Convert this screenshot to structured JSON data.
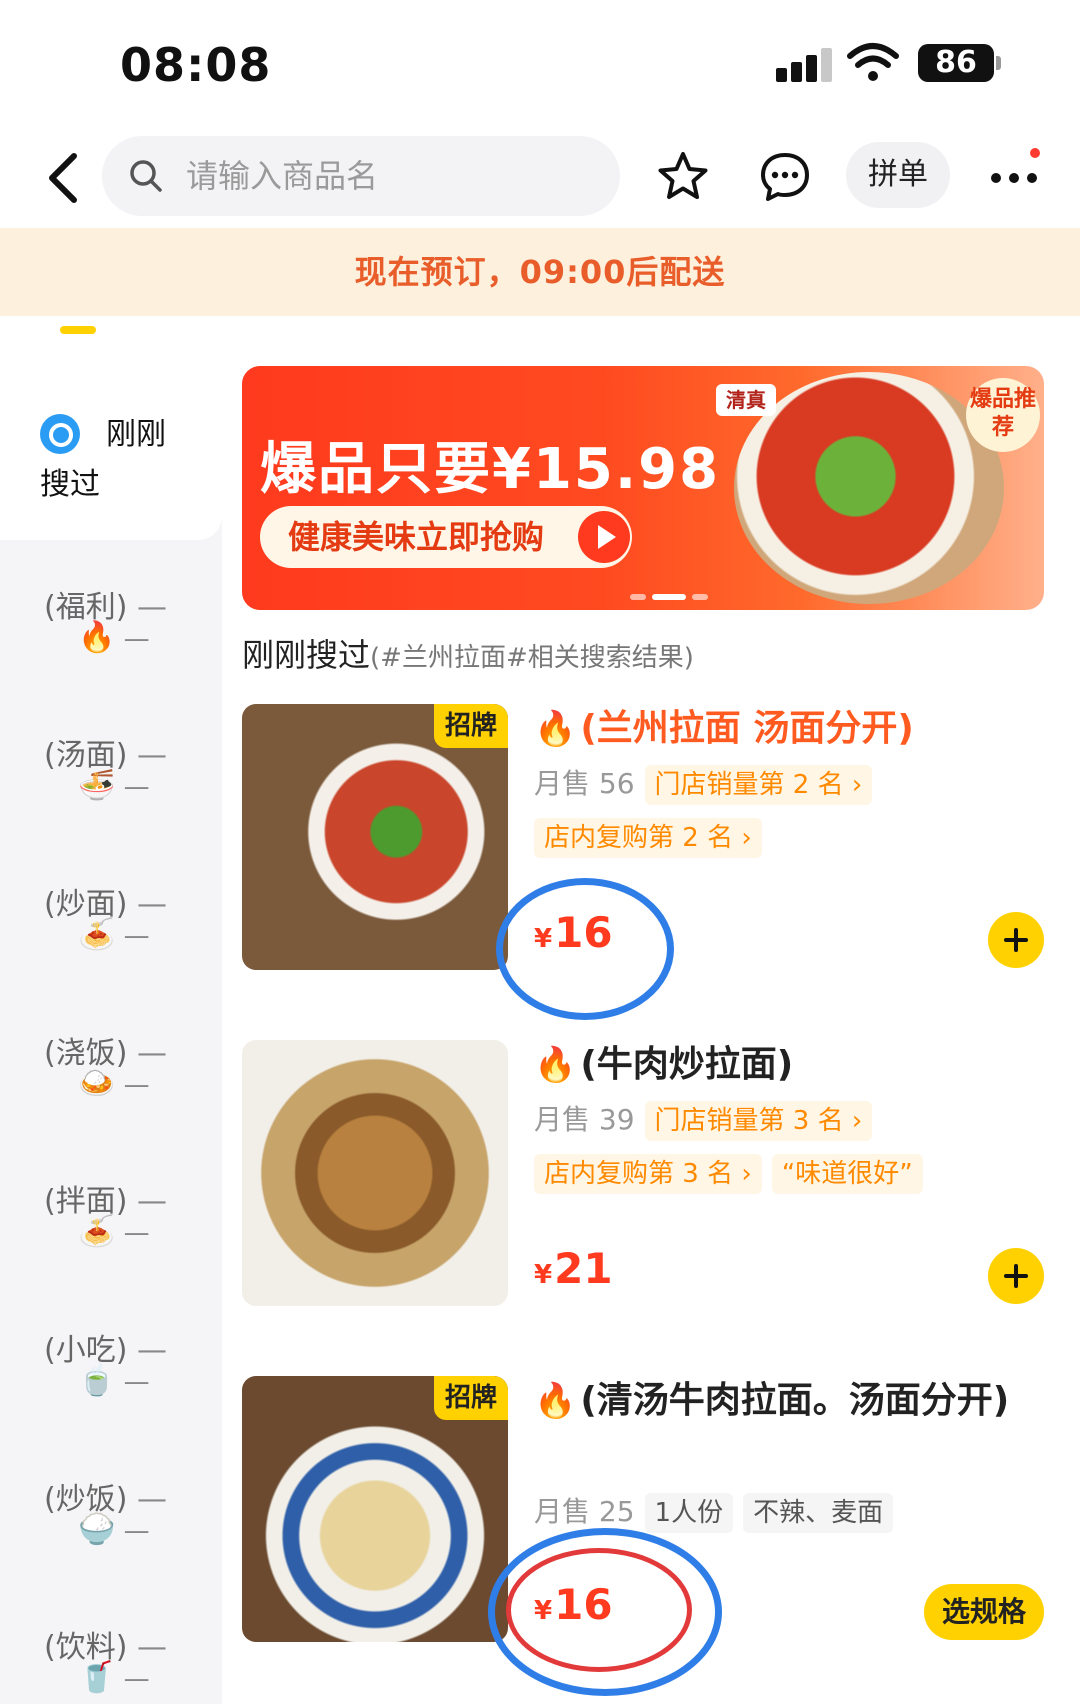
{
  "status_bar": {
    "time": "08:08",
    "battery": "86"
  },
  "nav": {
    "search_placeholder": "请输入商品名",
    "pin_label": "拼单"
  },
  "notice": "现在预订，09:00后配送",
  "sidebar": {
    "active_label": "刚刚搜过",
    "categories": [
      {
        "label": "(福利)",
        "emoji": "🔥"
      },
      {
        "label": "(汤面)",
        "emoji": "🍜"
      },
      {
        "label": "(炒面)",
        "emoji": "🍝"
      },
      {
        "label": "(浇饭)",
        "emoji": "🍛"
      },
      {
        "label": "(拌面)",
        "emoji": "🍝"
      },
      {
        "label": "(小吃)",
        "emoji": "🍵"
      },
      {
        "label": "(炒饭)",
        "emoji": "🍚"
      },
      {
        "label": "(饮料)",
        "emoji": "🥤"
      }
    ]
  },
  "banner": {
    "title": "爆品只要¥15.98",
    "subtitle": "健康美味立即抢购",
    "tag": "清真",
    "badge": "爆品推荐"
  },
  "section": {
    "title": "刚刚搜过",
    "hint": "(#兰州拉面#相关搜索结果)"
  },
  "products": [
    {
      "name": "(兰州拉面 汤面分开)",
      "badge": "招牌",
      "sales": "月售 56",
      "rank1": "门店销量第 2 名",
      "rank2": "店内复购第 2 名",
      "price": "16",
      "currency": "¥"
    },
    {
      "name": "(牛肉炒拉面)",
      "sales": "月售 39",
      "rank1": "门店销量第 3 名",
      "rank2": "店内复购第 3 名",
      "review": "“味道很好”",
      "price": "21",
      "currency": "¥"
    },
    {
      "name": "(清汤牛肉拉面。汤面分开)",
      "badge": "招牌",
      "sales": "月售 25",
      "tag1": "1人份",
      "tag2": "不辣、麦面",
      "price": "16",
      "currency": "¥",
      "spec_label": "选规格"
    }
  ],
  "colors": {
    "accent_yellow": "#ffd100",
    "price_red": "#ff3a1e",
    "notice_bg": "#fdf0dc",
    "annotation_blue": "#2f7ee8"
  }
}
